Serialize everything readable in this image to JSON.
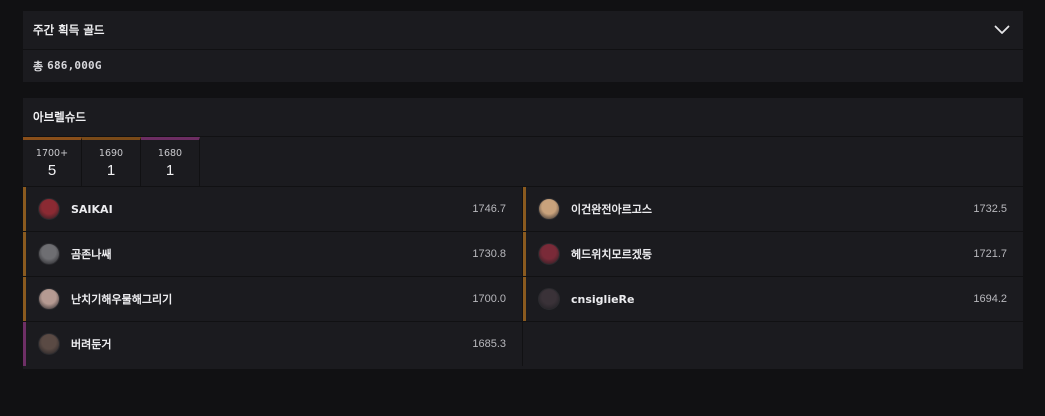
{
  "gold": {
    "title": "주간 획득 골드",
    "total_label": "총",
    "total_value": "686,000G"
  },
  "raid": {
    "title": "아브렐슈드",
    "tabs": [
      {
        "level": "1700+",
        "count": "5"
      },
      {
        "level": "1690",
        "count": "1"
      },
      {
        "level": "1680",
        "count": "1"
      }
    ],
    "characters": [
      {
        "name": "SAIKAI",
        "score": "1746.7",
        "avatar_color": "#8b2a33"
      },
      {
        "name": "이건완전아르고스",
        "score": "1732.5",
        "avatar_color": "#c9a27c"
      },
      {
        "name": "곰존나쌔",
        "score": "1730.8",
        "avatar_color": "#6e6e72"
      },
      {
        "name": "헤드위치모르겠둥",
        "score": "1721.7",
        "avatar_color": "#7a2a38"
      },
      {
        "name": "난치기해우물해그리기",
        "score": "1700.0",
        "avatar_color": "#b59a92"
      },
      {
        "name": "cnsiglieRe",
        "score": "1694.2",
        "avatar_color": "#3a3238"
      },
      {
        "name": "버려둔거",
        "score": "1685.3",
        "avatar_color": "#5a4a44"
      }
    ]
  },
  "colors": {
    "background": "#111113",
    "panel": "#1b1b1f",
    "tier_1700": "#8a5a1f",
    "tier_1680": "#6e2f66"
  }
}
